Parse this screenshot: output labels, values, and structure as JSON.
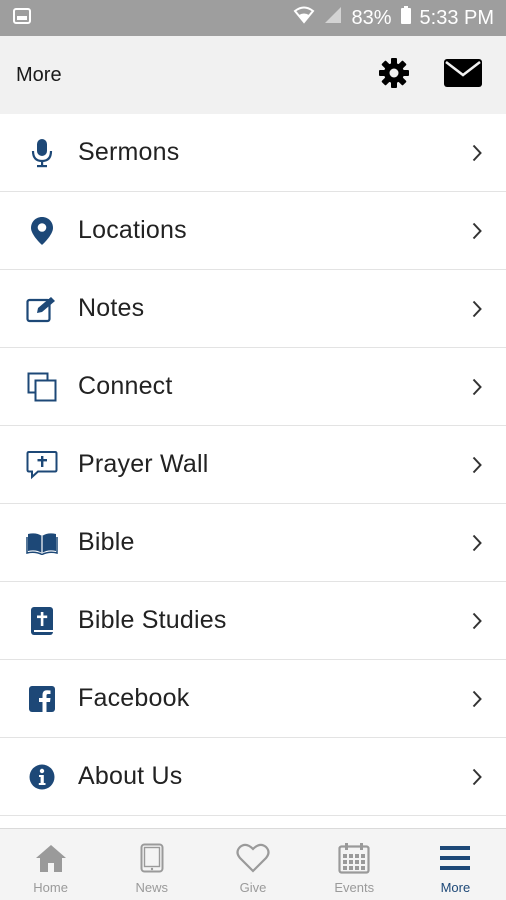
{
  "status_bar": {
    "battery": "83%",
    "time": "5:33 PM"
  },
  "header": {
    "title": "More",
    "actions": [
      {
        "icon": "gear-icon"
      },
      {
        "icon": "envelope-icon"
      }
    ]
  },
  "menu": {
    "items": [
      {
        "label": "Sermons",
        "icon": "microphone-icon"
      },
      {
        "label": "Locations",
        "icon": "map-pin-icon"
      },
      {
        "label": "Notes",
        "icon": "edit-icon"
      },
      {
        "label": "Connect",
        "icon": "copy-icon"
      },
      {
        "label": "Prayer Wall",
        "icon": "prayer-bubble-icon"
      },
      {
        "label": "Bible",
        "icon": "open-book-icon"
      },
      {
        "label": "Bible Studies",
        "icon": "bible-icon"
      },
      {
        "label": "Facebook",
        "icon": "facebook-icon"
      },
      {
        "label": "About Us",
        "icon": "info-icon"
      }
    ]
  },
  "bottom_nav": {
    "items": [
      {
        "label": "Home",
        "icon": "home-icon",
        "active": false
      },
      {
        "label": "News",
        "icon": "tablet-icon",
        "active": false
      },
      {
        "label": "Give",
        "icon": "heart-icon",
        "active": false
      },
      {
        "label": "Events",
        "icon": "calendar-icon",
        "active": false
      },
      {
        "label": "More",
        "icon": "menu-icon",
        "active": true
      }
    ]
  },
  "colors": {
    "accent": "#1d4877",
    "status_bar": "#9e9e9e",
    "header_bg": "#f1f1f1",
    "nav_inactive": "#9a9a9a"
  }
}
